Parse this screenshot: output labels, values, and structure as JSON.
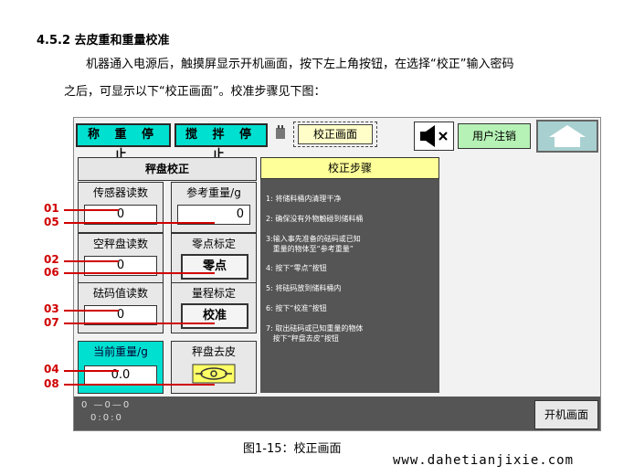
{
  "section_heading": "4.5.2 去皮重和重量校准",
  "paragraph_line1": "机器通入电源后，触摸屏显示开机画面，按下左上角按钮，在选择“校正”输入密码",
  "paragraph_line2": "之后，可显示以下“校正画面”。校准步骤见下图：",
  "screen": {
    "top_buttons": {
      "weigh_stop": "称 重 停 止",
      "stir_stop": "搅 拌 停 止"
    },
    "calibration_tab": "校正画面",
    "user_logout": "用户注销",
    "left_title": "秤盘校正",
    "cells": {
      "sensor_reading_label": "传感器读数",
      "sensor_reading_value": "0",
      "ref_weight_label": "参考重量/g",
      "ref_weight_value": "0",
      "empty_pan_label": "空秤盘读数",
      "empty_pan_value": "0",
      "zero_cal_label": "零点标定",
      "zero_cal_button": "零点",
      "weight_reading_label": "砝码值读数",
      "weight_reading_value": "0",
      "span_cal_label": "量程标定",
      "span_cal_button": "校准",
      "current_weight_label": "当前重量/g",
      "current_weight_value": "0.0",
      "tare_label": "秤盘去皮"
    },
    "steps_title": "校正步骤",
    "steps": [
      "1: 将储料桶内清理干净",
      "2: 确保没有外物触碰到储料桶",
      "3:输入事先准备的砝码或已知\n   重量的物体至“参考重量”",
      "4: 按下“零点”按钮",
      "5: 将砝码放到储料桶内",
      "6: 按下“校准”按钮",
      "7: 取出砝码或已知重量的物体\n   按下“秤盘去皮”按钮"
    ],
    "bottom_line1": "0 —0—0",
    "bottom_line2": "0:0:0",
    "boot_screen_button": "开机画面"
  },
  "callouts": [
    "01",
    "05",
    "02",
    "06",
    "03",
    "07",
    "04",
    "08"
  ],
  "figure_caption": "图1-15：校正画面",
  "website": "www.dahetianjixie.com",
  "colors": {
    "teal": "#00e0d0",
    "panel": "#555555",
    "red": "#d00000",
    "yellow": "#ffff99",
    "green": "#b6f2b6"
  }
}
